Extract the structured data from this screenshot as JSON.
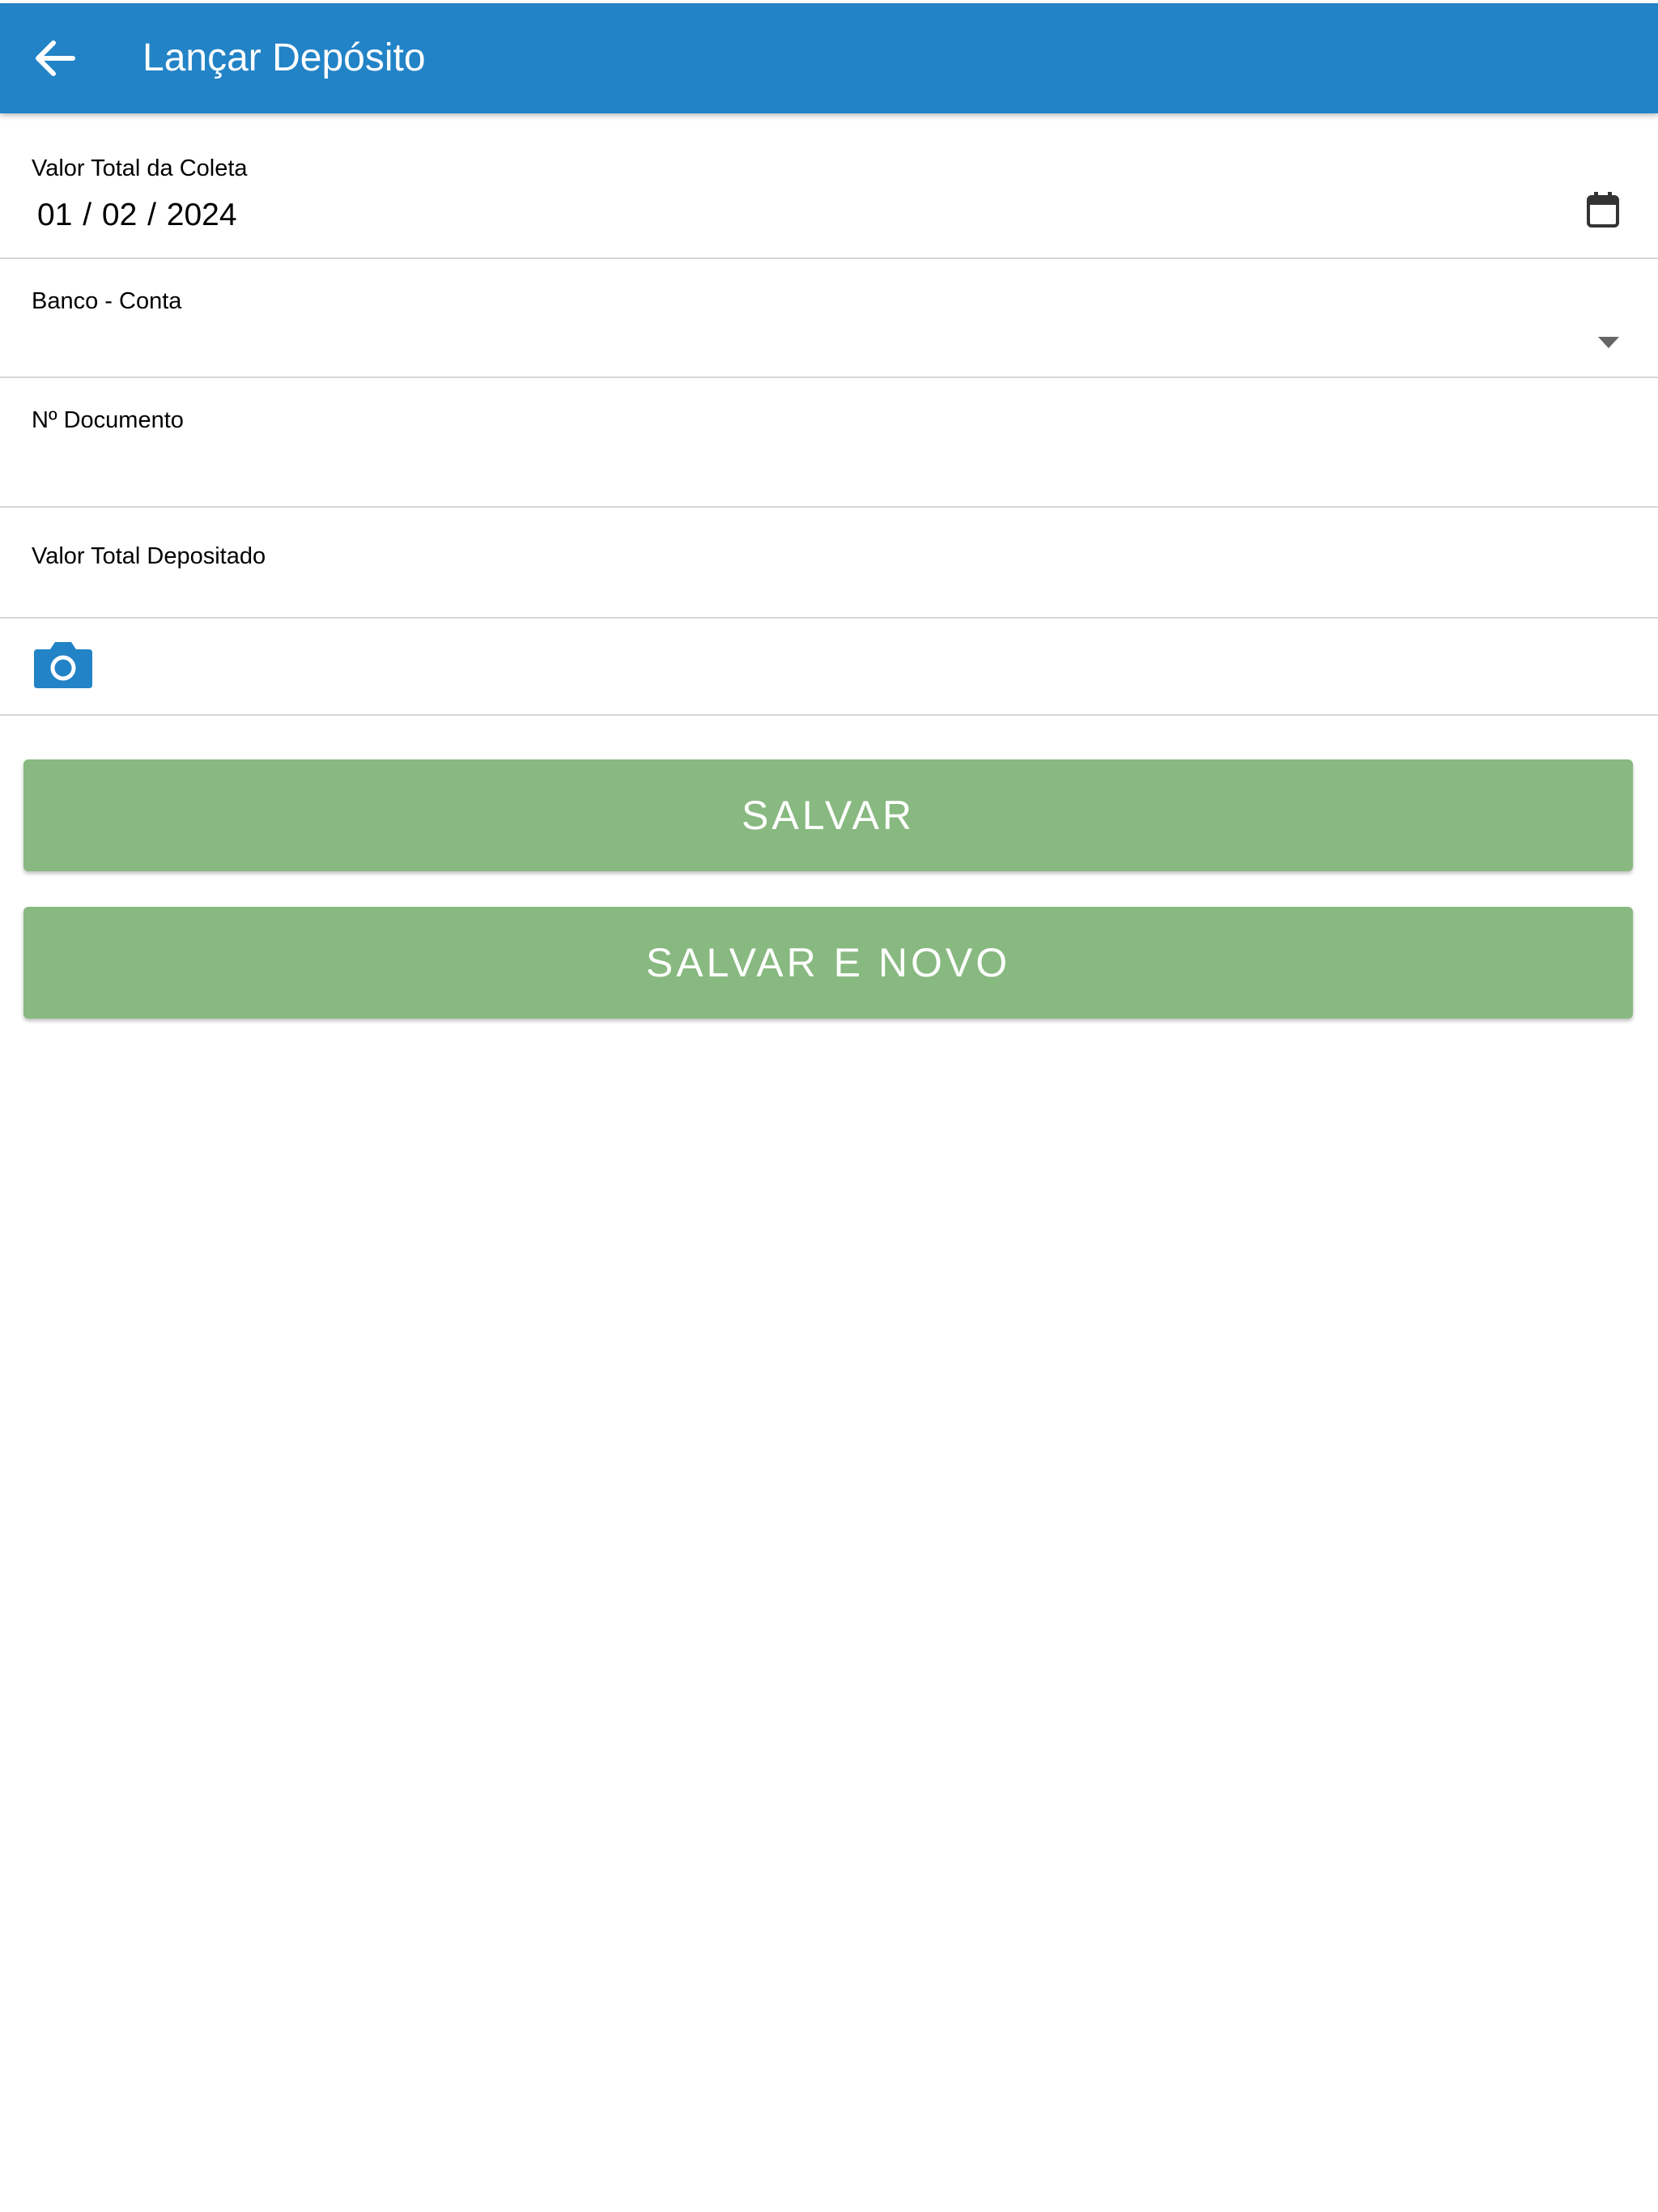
{
  "header": {
    "title": "Lançar Depósito",
    "back_icon": "arrow-left-icon",
    "background_color": "#2283c7"
  },
  "form": {
    "date_field": {
      "label": "Valor Total da Coleta",
      "value": "01 / 02 / 2024",
      "icon": "calendar-icon"
    },
    "bank_field": {
      "label": "Banco - Conta",
      "value": "",
      "icon": "chevron-down-icon"
    },
    "document_field": {
      "label": "Nº Documento",
      "value": ""
    },
    "deposit_total_field": {
      "label": "Valor Total Depositado",
      "value": ""
    },
    "photo": {
      "icon": "camera-icon",
      "color": "#2283c7"
    }
  },
  "actions": {
    "save_label": "SALVAR",
    "save_and_new_label": "SALVAR E NOVO",
    "button_color": "#88b980"
  }
}
